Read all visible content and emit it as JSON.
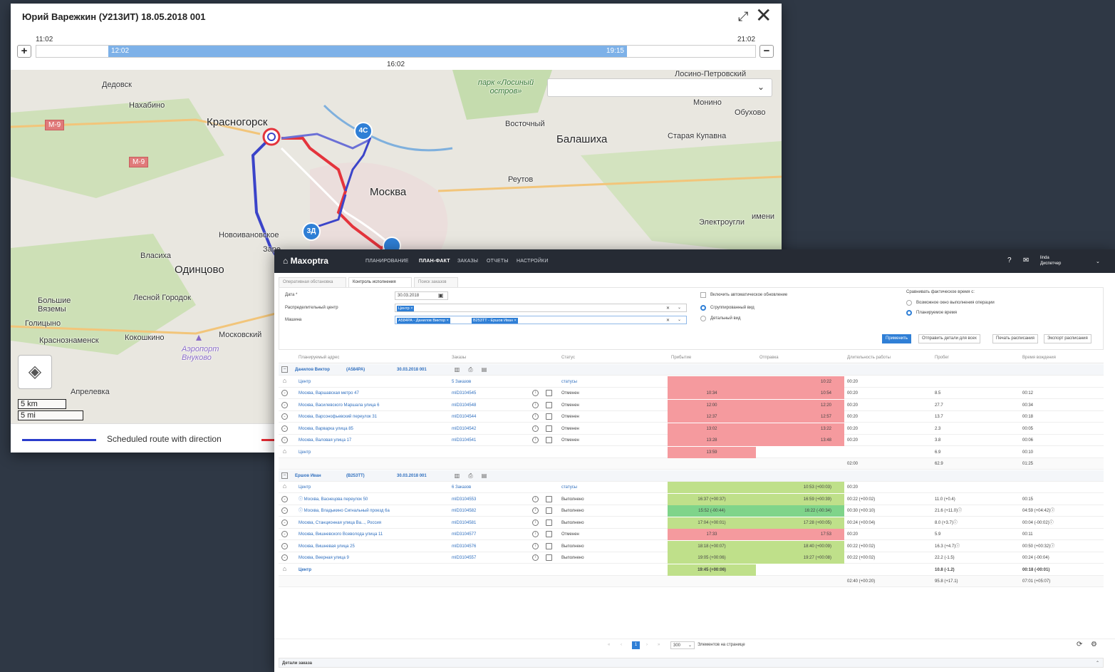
{
  "map_window": {
    "title": "Юрий Варежкин (У213ИТ) 18.05.2018 001",
    "expand_icon": "expand-icon",
    "close_icon": "close-icon",
    "timeline": {
      "start_time": "11:02",
      "end_time": "21:02",
      "range_start": "12:02",
      "range_end": "19:15",
      "current_time": "16:02",
      "zoom_in": "+",
      "zoom_out": "−"
    },
    "map_labels": {
      "dedovsk": "Дедовск",
      "nakhabino": "Нахабино",
      "krasnogorsk": "Красногорск",
      "moscow": "Москва",
      "balashikha": "Балашиха",
      "vostochny": "Восточный",
      "reutov": "Реутов",
      "staraya_kupavna": "Старая Купавна",
      "monino": "Монино",
      "obukhovo": "Обухово",
      "losiny": "Лосино-Петровский",
      "park": "парк «Лосиный остров»",
      "odintsovo": "Одинцово",
      "vlasikha": "Власиха",
      "novoivankovskoe": "Новоивановское",
      "lesnoy": "Лесной Городок",
      "bolshie": "Большие Вяземы",
      "golitsyno": "Голицыно",
      "krasnoznamensk": "Краснознаменск",
      "kokoshkino": "Кокошкино",
      "moskovsky": "Московский",
      "aprelevka": "Апрелевка",
      "vnukovo": "Аэропорт Внуково",
      "elektrougli": "Электроугли",
      "imeni": "имени",
      "zarech": "Заре"
    },
    "road_m9_a": "M-9",
    "road_m9_b": "M-9",
    "markers": {
      "m1": "4С",
      "m2": "3Д"
    },
    "scale_km": "5 km",
    "scale_mi": "5 mi",
    "legend_text": "Scheduled route with direction"
  },
  "app": {
    "logo": "Maxoptra",
    "nav": [
      "ПЛАНИРОВАНИЕ",
      "ПЛАН-ФАКТ",
      "ЗАКАЗЫ",
      "ОТЧЕТЫ",
      "НАСТРОЙКИ"
    ],
    "user_name": "linda",
    "user_role": "Диспетчер",
    "tabs": [
      "Оперативная обстановка",
      "Контроль исполнения",
      "Поиск заказов"
    ],
    "filter": {
      "date_label": "Дата *",
      "date_value": "30.03.2018",
      "dc_label": "Распределительный центр",
      "dc_chip": "Центр ×",
      "vehicle_label": "Машина",
      "vehicle_chip1": "А584РА - Данилов Виктор ×",
      "vehicle_chip2": "В253ТТ - Ершов Иван ×",
      "auto_refresh": "Включить автоматическое обновление",
      "grouped_view": "Сгруппированный вид",
      "detailed_view": "Детальный вид",
      "compare_label": "Сравнивать фактическое время с:",
      "compare_opt1": "Возможное окно выполнения операции",
      "compare_opt2": "Планируемое время"
    },
    "buttons": {
      "apply": "Применить",
      "send_all": "Отправить детали для всех",
      "print": "Печать расписания",
      "export": "Экспорт расписания"
    },
    "columns": [
      "Планируемый адрес",
      "Заказы",
      "Статус",
      "Прибытие",
      "Отправка",
      "Длительность работы",
      "Пробег",
      "Время вождения"
    ],
    "groups": [
      {
        "driver": "Данилов Виктор",
        "plate": "(А584РА)",
        "date": "30.03.2018 001",
        "rows": [
          {
            "addr": "Центр",
            "order": "5 Заказов",
            "status": "статусы",
            "arr": "",
            "dep": "10:22",
            "dur": "00:20",
            "km": "",
            "drv": "",
            "color": "red",
            "depot": true
          },
          {
            "addr": "Москва, Варшавская метро 47",
            "order": "mID3104545",
            "status": "Отменен",
            "arr": "10:34",
            "dep": "10:54",
            "dur": "00:20",
            "km": "8.5",
            "drv": "00:12",
            "color": "red"
          },
          {
            "addr": "Москва, Василевского Маршала улица 6",
            "order": "mID3104548",
            "status": "Отменен",
            "arr": "12:00",
            "dep": "12:20",
            "dur": "00:20",
            "km": "27.7",
            "drv": "00:34",
            "color": "red"
          },
          {
            "addr": "Москва, Варсонофьевский переулок 31",
            "order": "mID3104544",
            "status": "Отменен",
            "arr": "12:37",
            "dep": "12:57",
            "dur": "00:20",
            "km": "13.7",
            "drv": "00:18",
            "color": "red"
          },
          {
            "addr": "Москва, Варварка улица 85",
            "order": "mID3104542",
            "status": "Отменен",
            "arr": "13:02",
            "dep": "13:22",
            "dur": "00:20",
            "km": "2.3",
            "drv": "00:05",
            "color": "red"
          },
          {
            "addr": "Москва, Валовая улица 17",
            "order": "mID3104541",
            "status": "Отменен",
            "arr": "13:28",
            "dep": "13:48",
            "dur": "00:20",
            "km": "3.8",
            "drv": "00:06",
            "color": "red"
          },
          {
            "addr": "Центр",
            "order": "",
            "status": "",
            "arr": "13:59",
            "dep": "",
            "dur": "",
            "km": "6.9",
            "drv": "00:10",
            "color": "red",
            "depot": true
          }
        ],
        "total": {
          "dur": "02:00",
          "km": "62.9",
          "drv": "01:25"
        }
      },
      {
        "driver": "Ершов Иван",
        "plate": "(В253ТТ)",
        "date": "30.03.2018 001",
        "rows": [
          {
            "addr": "Центр",
            "order": "6 Заказов",
            "status": "статусы",
            "arr": "",
            "dep": "10:53 (+00:03)",
            "dur": "00:20",
            "km": "",
            "drv": "",
            "color": "green",
            "depot": true
          },
          {
            "addr": "ⓘ Москва, Васнецова переулок 50",
            "order": "mID3104553",
            "status": "Выполнено",
            "arr": "16:37 (+00:37)",
            "dep": "16:59 (+00:39)",
            "dur": "00:22 (+00:02)",
            "km": "11.0 (+0.4)",
            "drv": "00:15",
            "color": "green",
            "warn": true
          },
          {
            "addr": "ⓘ Москва, Владыкино Сигнальный проезд 6а",
            "order": "mID3104582",
            "status": "Выполнено",
            "arr": "15:52 (-00:44)",
            "dep": "16:22 (-00:34)",
            "dur": "00:30 (+00:10)",
            "km": "21.6 (+11.0)ⓘ",
            "drv": "04:59 (+04:42)ⓘ",
            "color": "dgreen",
            "warn": true
          },
          {
            "addr": "Москва, Станционная улица Ва..., Россия",
            "order": "mID3104581",
            "status": "Выполнено",
            "arr": "17:04 (+00:01)",
            "dep": "17:28 (+00:05)",
            "dur": "00:24 (+00:04)",
            "km": "8.0 (+3.7)ⓘ",
            "drv": "00:04 (-00:02)ⓘ",
            "color": "green"
          },
          {
            "addr": "Москва, Вишневского Всеволода улица 11",
            "order": "mID3104577",
            "status": "Отменен",
            "arr": "17:33",
            "dep": "17:53",
            "dur": "00:20",
            "km": "5.9",
            "drv": "00:11",
            "color": "red"
          },
          {
            "addr": "Москва, Вишневая улица 25",
            "order": "mID3104576",
            "status": "Выполнено",
            "arr": "18:18 (+00:07)",
            "dep": "18:40 (+00:09)",
            "dur": "00:22 (+00:02)",
            "km": "16.3 (+4.7)ⓘ",
            "drv": "00:50 (+00:32)ⓘ",
            "color": "green"
          },
          {
            "addr": "Москва, Веерная улица 9",
            "order": "mID3104557",
            "status": "Выполнено",
            "arr": "19:05 (+00:06)",
            "dep": "19:27 (+00:08)",
            "dur": "00:22 (+00:02)",
            "km": "22.2 (-1.5)",
            "drv": "00:24 (-00:04)",
            "color": "green"
          },
          {
            "addr": "Центр",
            "order": "",
            "status": "",
            "arr": "19:45 (+00:06)",
            "dep": "",
            "dur": "",
            "km": "10.8 (-1.2)",
            "drv": "00:18 (-00:01)",
            "color": "green",
            "depot": true,
            "boldrow": true
          }
        ],
        "total": {
          "dur": "02:40 (+00:20)",
          "km": "95.8 (+17.1)",
          "drv": "07:01 (+05:07)"
        }
      }
    ],
    "pager": {
      "current": "1",
      "size": "300",
      "label": "Элементов на странице"
    },
    "details_label": "Детали заказа"
  }
}
